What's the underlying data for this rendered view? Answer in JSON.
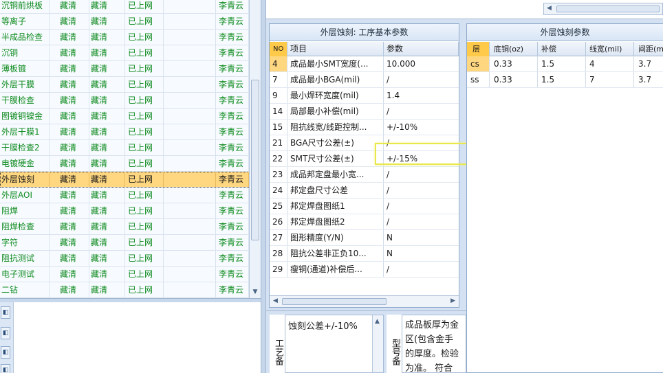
{
  "process_rows": [
    [
      "沉铜前烘板",
      "藏清",
      "藏清",
      "已上网",
      "",
      "李青云"
    ],
    [
      "等离子",
      "藏清",
      "藏清",
      "已上网",
      "",
      "李青云"
    ],
    [
      "半成品检查",
      "藏清",
      "藏清",
      "已上网",
      "",
      "李青云"
    ],
    [
      "沉铜",
      "藏清",
      "藏清",
      "已上网",
      "",
      "李青云"
    ],
    [
      "薄板镀",
      "藏清",
      "藏清",
      "已上网",
      "",
      "李青云"
    ],
    [
      "外层干膜",
      "藏清",
      "藏清",
      "已上网",
      "",
      "李青云"
    ],
    [
      "干膜检查",
      "藏清",
      "藏清",
      "已上网",
      "",
      "李青云"
    ],
    [
      "图镀铜镍金",
      "藏清",
      "藏清",
      "已上网",
      "",
      "李青云"
    ],
    [
      "外层干膜1",
      "藏清",
      "藏清",
      "已上网",
      "",
      "李青云"
    ],
    [
      "干膜检查2",
      "藏清",
      "藏清",
      "已上网",
      "",
      "李青云"
    ],
    [
      "电镀硬金",
      "藏清",
      "藏清",
      "已上网",
      "",
      "李青云"
    ],
    [
      "外层蚀刻",
      "藏清",
      "藏清",
      "已上网",
      "",
      "李青云"
    ],
    [
      "外层AOI",
      "藏清",
      "藏清",
      "已上网",
      "",
      "李青云"
    ],
    [
      "阻焊",
      "藏清",
      "藏清",
      "已上网",
      "",
      "李青云"
    ],
    [
      "阻焊检查",
      "藏清",
      "藏清",
      "已上网",
      "",
      "李青云"
    ],
    [
      "字符",
      "藏清",
      "藏清",
      "已上网",
      "",
      "李青云"
    ],
    [
      "阻抗测试",
      "藏清",
      "藏清",
      "已上网",
      "",
      "李青云"
    ],
    [
      "电子测试",
      "藏清",
      "藏清",
      "已上网",
      "",
      "李青云"
    ],
    [
      "二钻",
      "藏清",
      "藏清",
      "已上网",
      "",
      "李青云"
    ]
  ],
  "selected_process_index": 11,
  "side_buttons": [
    "",
    "",
    "",
    ""
  ],
  "params_panel": {
    "title": "外层蚀刻: 工序基本参数",
    "col_no": "NO",
    "col_item": "项目",
    "col_value": "参数",
    "rows": [
      {
        "no": "4",
        "item": "成品最小SMT宽度(...",
        "value": "10.000"
      },
      {
        "no": "7",
        "item": "成品最小BGA(mil)",
        "value": "/"
      },
      {
        "no": "9",
        "item": "最小焊环宽度(mil)",
        "value": "1.4"
      },
      {
        "no": "14",
        "item": "局部最小补偿(mil)",
        "value": "/"
      },
      {
        "no": "15",
        "item": "阻抗线宽/线距控制...",
        "value": "+/-10%"
      },
      {
        "no": "21",
        "item": "BGA尺寸公差(±)",
        "value": "/"
      },
      {
        "no": "22",
        "item": "SMT尺寸公差(±)",
        "value": "+/-15%"
      },
      {
        "no": "23",
        "item": "成品邦定盘最小宽...",
        "value": "/"
      },
      {
        "no": "24",
        "item": "邦定盘尺寸公差",
        "value": "/"
      },
      {
        "no": "25",
        "item": "邦定焊盘图纸1",
        "value": "/"
      },
      {
        "no": "26",
        "item": "邦定焊盘图纸2",
        "value": "/"
      },
      {
        "no": "27",
        "item": "图形精度(Y/N)",
        "value": "N"
      },
      {
        "no": "28",
        "item": "阻抗公差非正负10...",
        "value": "N"
      },
      {
        "no": "29",
        "item": "瘦铜(通道)补偿后...",
        "value": "/"
      }
    ]
  },
  "etch_panel": {
    "title": "外层蚀刻参数",
    "headers": [
      "层",
      "底铜(oz)",
      "补偿",
      "线宽(mil)",
      "间距(m"
    ],
    "rows": [
      [
        "cs",
        "0.33",
        "1.5",
        "4",
        "3.7"
      ],
      [
        "ss",
        "0.33",
        "1.5",
        "7",
        "3.7"
      ]
    ]
  },
  "craft_note": {
    "label": "工艺备",
    "text": "蚀刻公差+/-10%"
  },
  "model_note": {
    "label": "型号备",
    "lines": [
      "成品板厚为金",
      "区(包含金手",
      "的厚度。检验",
      "为准。 符合"
    ]
  },
  "colors": {
    "process_text": "#0e8a1e",
    "selected_row": "#ffd780",
    "highlight_box": "#e8e84a"
  }
}
